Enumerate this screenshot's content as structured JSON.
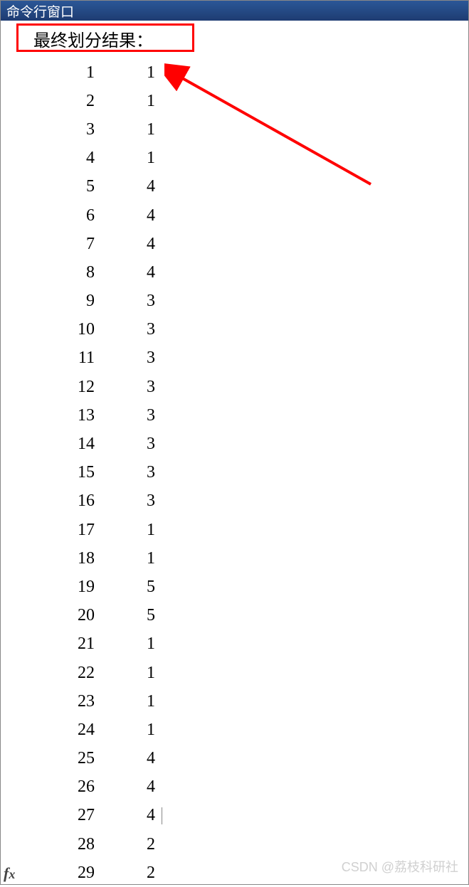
{
  "window": {
    "title": "命令行窗口"
  },
  "output": {
    "header": "最终划分结果：",
    "rows": [
      {
        "index": "1",
        "value": "1"
      },
      {
        "index": "2",
        "value": "1"
      },
      {
        "index": "3",
        "value": "1"
      },
      {
        "index": "4",
        "value": "1"
      },
      {
        "index": "5",
        "value": "4"
      },
      {
        "index": "6",
        "value": "4"
      },
      {
        "index": "7",
        "value": "4"
      },
      {
        "index": "8",
        "value": "4"
      },
      {
        "index": "9",
        "value": "3"
      },
      {
        "index": "10",
        "value": "3"
      },
      {
        "index": "11",
        "value": "3"
      },
      {
        "index": "12",
        "value": "3"
      },
      {
        "index": "13",
        "value": "3"
      },
      {
        "index": "14",
        "value": "3"
      },
      {
        "index": "15",
        "value": "3"
      },
      {
        "index": "16",
        "value": "3"
      },
      {
        "index": "17",
        "value": "1"
      },
      {
        "index": "18",
        "value": "1"
      },
      {
        "index": "19",
        "value": "5"
      },
      {
        "index": "20",
        "value": "5"
      },
      {
        "index": "21",
        "value": "1"
      },
      {
        "index": "22",
        "value": "1"
      },
      {
        "index": "23",
        "value": "1"
      },
      {
        "index": "24",
        "value": "1"
      },
      {
        "index": "25",
        "value": "4"
      },
      {
        "index": "26",
        "value": "4"
      },
      {
        "index": "27",
        "value": "4"
      },
      {
        "index": "28",
        "value": "2"
      },
      {
        "index": "29",
        "value": "2"
      }
    ]
  },
  "watermark": "CSDN @荔枝科研社",
  "annotation": {
    "highlight_color": "#ff0000",
    "arrow_color": "#ff0000"
  }
}
